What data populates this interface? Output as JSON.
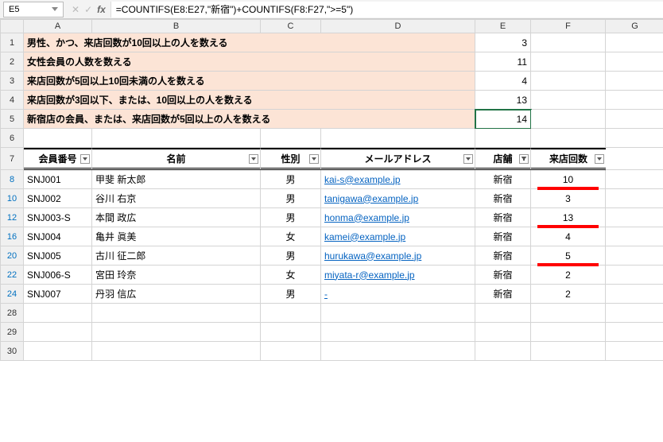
{
  "name_box": "E5",
  "formula": "=COUNTIFS(E8:E27,\"新宿\")+COUNTIFS(F8:F27,\">=5\")",
  "cols": [
    "A",
    "B",
    "C",
    "D",
    "E",
    "F",
    "G"
  ],
  "desc_rows": [
    {
      "n": "1",
      "t": "男性、かつ、来店回数が10回以上の人を数える",
      "v": "3"
    },
    {
      "n": "2",
      "t": "女性会員の人数を数える",
      "v": "11"
    },
    {
      "n": "3",
      "t": "来店回数が5回以上10回未満の人を数える",
      "v": "4"
    },
    {
      "n": "4",
      "t": "来店回数が3回以下、または、10回以上の人を数える",
      "v": "13"
    },
    {
      "n": "5",
      "t": "新宿店の会員、または、来店回数が5回以上の人を数える",
      "v": "14",
      "sel": true
    }
  ],
  "row6": "6",
  "row7": "7",
  "headers": {
    "id": "会員番号",
    "name": "名前",
    "sex": "性別",
    "mail": "メールアドレス",
    "shop": "店舗",
    "visit": "来店回数"
  },
  "data_rows": [
    {
      "n": "8",
      "id": "SNJ001",
      "name": "甲斐 新太郎",
      "sex": "男",
      "mail": "kai-s@example.jp",
      "shop": "新宿",
      "visit": "10",
      "red": true
    },
    {
      "n": "10",
      "id": "SNJ002",
      "name": "谷川 右京",
      "sex": "男",
      "mail": "tanigawa@example.jp",
      "shop": "新宿",
      "visit": "3"
    },
    {
      "n": "12",
      "id": "SNJ003-S",
      "name": "本間 政広",
      "sex": "男",
      "mail": "honma@example.jp",
      "shop": "新宿",
      "visit": "13",
      "red": true
    },
    {
      "n": "16",
      "id": "SNJ004",
      "name": "亀井 眞美",
      "sex": "女",
      "mail": "kamei@example.jp",
      "shop": "新宿",
      "visit": "4"
    },
    {
      "n": "20",
      "id": "SNJ005",
      "name": "古川 征二郎",
      "sex": "男",
      "mail": "hurukawa@example.jp",
      "shop": "新宿",
      "visit": "5",
      "red": true
    },
    {
      "n": "22",
      "id": "SNJ006-S",
      "name": "宮田 玲奈",
      "sex": "女",
      "mail": "miyata-r@example.jp",
      "shop": "新宿",
      "visit": "2"
    },
    {
      "n": "24",
      "id": "SNJ007",
      "name": "丹羽 信広",
      "sex": "男",
      "mail": "-",
      "shop": "新宿",
      "visit": "2"
    }
  ],
  "empty_rows": [
    "28",
    "29",
    "30"
  ]
}
